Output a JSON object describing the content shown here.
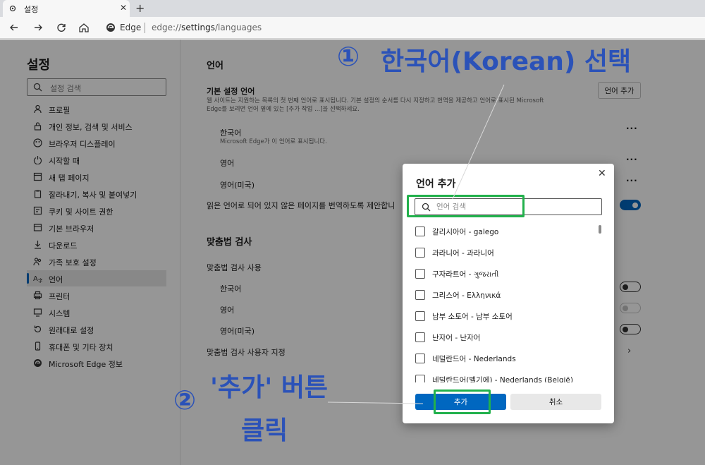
{
  "browser": {
    "tab_title": "설정",
    "new_tab": "+",
    "close_tab": "✕",
    "address_brand": "Edge",
    "address_prefix": "edge://",
    "address_bold": "settings",
    "address_suffix": "/languages"
  },
  "sidebar": {
    "title": "설정",
    "search_placeholder": "설정 검색",
    "items": [
      {
        "label": "프로필",
        "icon": "profile-icon"
      },
      {
        "label": "개인 정보, 검색 및 서비스",
        "icon": "lock-icon"
      },
      {
        "label": "브라우저 디스플레이",
        "icon": "palette-icon"
      },
      {
        "label": "시작할 때",
        "icon": "power-icon"
      },
      {
        "label": "새 탭 페이지",
        "icon": "new-tab-icon"
      },
      {
        "label": "잘라내기, 복사 및 붙여넣기",
        "icon": "clipboard-icon"
      },
      {
        "label": "쿠키 및 사이트 권한",
        "icon": "cookie-icon"
      },
      {
        "label": "기본 브라우저",
        "icon": "browser-icon"
      },
      {
        "label": "다운로드",
        "icon": "download-icon"
      },
      {
        "label": "가족 보호 설정",
        "icon": "family-icon"
      },
      {
        "label": "언어",
        "icon": "language-icon"
      },
      {
        "label": "프린터",
        "icon": "printer-icon"
      },
      {
        "label": "시스템",
        "icon": "system-icon"
      },
      {
        "label": "원래대로 설정",
        "icon": "reset-icon"
      },
      {
        "label": "휴대폰 및 기타 장치",
        "icon": "phone-icon"
      },
      {
        "label": "Microsoft Edge 정보",
        "icon": "edge-icon"
      }
    ],
    "active_item": "언어"
  },
  "main": {
    "section_language": "언어",
    "preferred_title": "기본 설정 언어",
    "preferred_desc_1": "웹 사이트는 지원하는 목록의 첫 번째 언어로 표시됩니다. 기본 설정의 순서를 다시 지정하고 번역을 제공하고 언어로 표시된 Microsoft",
    "preferred_desc_2": "Edge를 보려면 언어 옆에 있는 [추가 작업 ...]을 선택하세요.",
    "add_language_button": "언어 추가",
    "languages": [
      {
        "name": "한국어",
        "note": "Microsoft Edge가 이 언어로 표시됩니다."
      },
      {
        "name": "영어",
        "note": ""
      },
      {
        "name": "영어(미국)",
        "note": ""
      }
    ],
    "more_label": "···",
    "translate_offer": "읽은 언어로 되어 있지 않은 페이지를 번역하도록 제안합니",
    "translate_on": true,
    "section_spellcheck": "맞춤법 검사",
    "spellcheck_enable": "맞춤법 검사 사용",
    "spell_languages": [
      {
        "name": "한국어",
        "state": "off"
      },
      {
        "name": "영어",
        "state": "disabled"
      },
      {
        "name": "영어(미국)",
        "state": "off"
      }
    ],
    "custom_dictionary": "맞춤법 검사 사용자 지정"
  },
  "dialog": {
    "title": "언어 추가",
    "search_placeholder": "언어 검색",
    "options": [
      "갈리시아어 - galego",
      "과라니어 - 과라니어",
      "구자라트어 - ગુજરાતી",
      "그리스어 - Ελληνικά",
      "남부 소토어 - 남부 소토어",
      "난자어 - 난자어",
      "네덜란드어 - Nederlands",
      "네덜란드어(벨기에) - Nederlands (België)"
    ],
    "add_button": "추가",
    "cancel_button": "취소"
  },
  "annotations": {
    "step1_num": "①",
    "step1_text": "한국어(Korean) 선택",
    "step2_num": "②",
    "step2_text": "'추가' 버튼",
    "step2_text2": "클릭",
    "color": "#2b52b8",
    "highlight_color": "#22b14c"
  }
}
